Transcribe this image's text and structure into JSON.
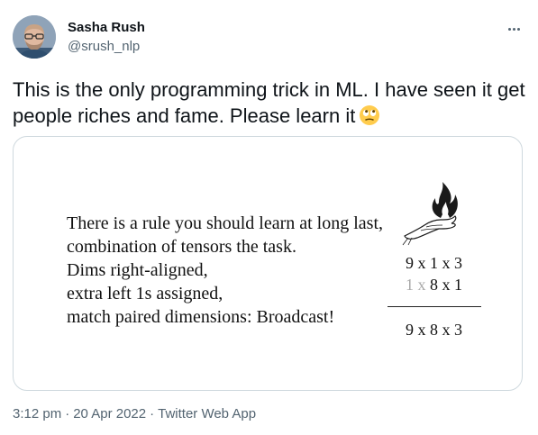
{
  "author": {
    "name": "Sasha Rush",
    "handle": "@srush_nlp"
  },
  "tweet": {
    "text": "This is the only programming trick in ML. I have seen it get people riches and fame. Please learn it",
    "emoji": "face-with-rolling-eyes"
  },
  "card": {
    "poem": [
      "There is a rule you should learn at long last,",
      "combination of tensors the task.",
      "Dims right-aligned,",
      "extra left 1s assigned,",
      "match paired dimensions: Broadcast!"
    ],
    "math": {
      "row1": "9 x 1 x 3",
      "row2_faint": "1 x",
      "row2_main": " 8 x 1",
      "result": "9 x 8 x 3"
    },
    "icon": "flaming-hand-icon"
  },
  "footer": {
    "time": "3:12 pm",
    "separator": "·",
    "date": "20 Apr 2022",
    "source": "Twitter Web App"
  },
  "colors": {
    "text_primary": "#0f1419",
    "text_secondary": "#536471",
    "border": "#cfd9de",
    "faint_digit": "#a8a8a8"
  }
}
